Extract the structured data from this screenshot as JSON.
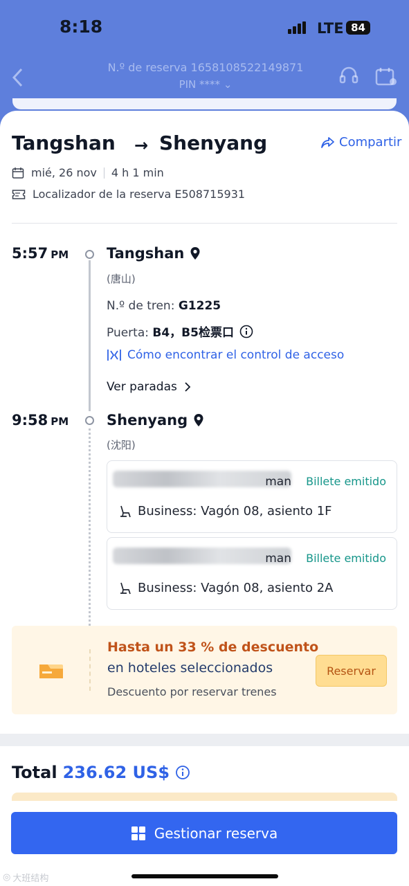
{
  "status_bar": {
    "time": "8:18",
    "network": "LTE",
    "battery": "84"
  },
  "header": {
    "reservation_number": "N.º de reserva 1658108522149871",
    "pin": "PIN ****"
  },
  "trip": {
    "from": "Tangshan",
    "to": "Shenyang",
    "share_label": "Compartir",
    "date": "mié, 26 nov",
    "duration": "4 h 1 min",
    "locator": "Localizador de la reserva E508715931"
  },
  "departure": {
    "time": "5:57",
    "meridiem": "PM",
    "station": "Tangshan",
    "station_cn": "(唐山)",
    "train_label": "N.º de tren: ",
    "train_number": "G1225",
    "gate_label": "Puerta: ",
    "gate_value": "B4，B5检票口",
    "access_link": "Cómo encontrar el control de acceso",
    "stops_link": "Ver paradas"
  },
  "arrival": {
    "time": "9:58",
    "meridiem": "PM",
    "station": "Shenyang",
    "station_cn": "(沈阳)"
  },
  "passengers": [
    {
      "name_tail": "man",
      "status": "Billete emitido",
      "seat": "Business: Vagón 08, asiento 1F"
    },
    {
      "name_tail": "man",
      "status": "Billete emitido",
      "seat": "Business: Vagón 08, asiento 2A"
    }
  ],
  "promo": {
    "title": "Hasta un 33 % de descuento",
    "subtitle": "en hoteles seleccionados",
    "note": "Descuento por reservar trenes",
    "button": "Reservar"
  },
  "total": {
    "label": "Total",
    "value": "236.62 US$"
  },
  "manage_button": "Gestionar reserva",
  "watermark": "大班结构",
  "colors": {
    "brand_blue": "#3366f0",
    "header_blue": "#5e7fdc",
    "status_green": "#16968a",
    "promo_orange": "#c0531a"
  }
}
